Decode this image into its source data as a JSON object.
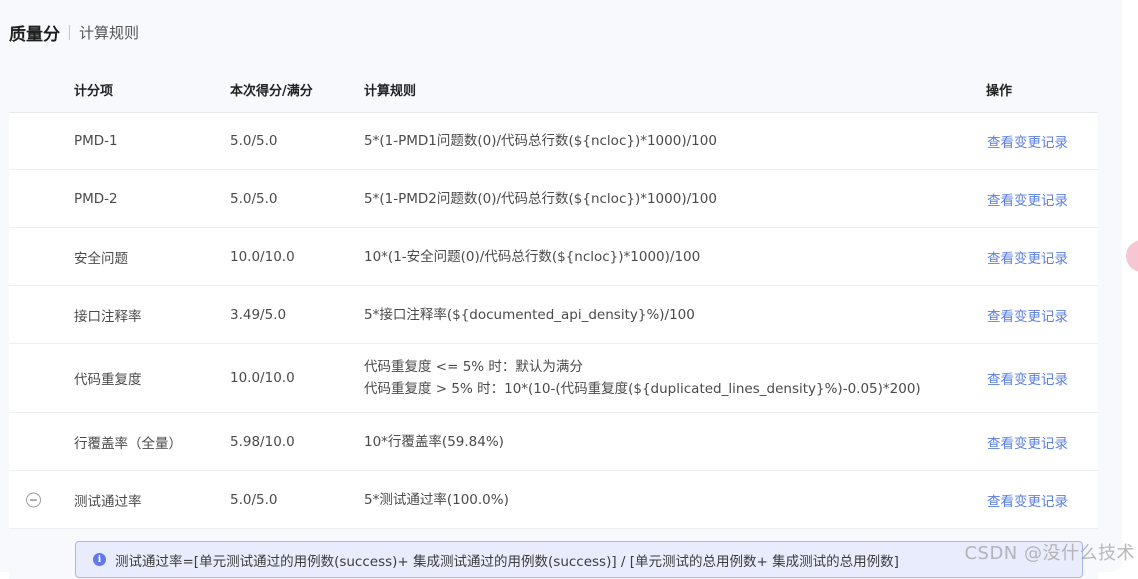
{
  "header": {
    "title": "质量分",
    "subtitle": "计算规则"
  },
  "table": {
    "columns": {
      "item": "计分项",
      "score": "本次得分/满分",
      "rule": "计算规则",
      "op": "操作"
    },
    "rows": [
      {
        "item": "PMD-1",
        "score": "5.0/5.0",
        "rule": [
          "5*(1-PMD1问题数(0)/代码总行数(${ncloc})*1000)/100"
        ],
        "op": "查看变更记录"
      },
      {
        "item": "PMD-2",
        "score": "5.0/5.0",
        "rule": [
          "5*(1-PMD2问题数(0)/代码总行数(${ncloc})*1000)/100"
        ],
        "op": "查看变更记录"
      },
      {
        "item": "安全问题",
        "score": "10.0/10.0",
        "rule": [
          "10*(1-安全问题(0)/代码总行数(${ncloc})*1000)/100"
        ],
        "op": "查看变更记录"
      },
      {
        "item": "接口注释率",
        "score": "3.49/5.0",
        "rule": [
          "5*接口注释率(${documented_api_density}%)/100"
        ],
        "op": "查看变更记录"
      },
      {
        "item": "代码重复度",
        "score": "10.0/10.0",
        "rule": [
          "代码重复度 <= 5% 时：默认为满分",
          "代码重复度 > 5% 时：10*(10-(代码重复度(${duplicated_lines_density}%)-0.05)*200)"
        ],
        "op": "查看变更记录"
      },
      {
        "item": "行覆盖率（全量）",
        "score": "5.98/10.0",
        "rule": [
          "10*行覆盖率(59.84%)"
        ],
        "op": "查看变更记录"
      },
      {
        "item": "测试通过率",
        "score": "5.0/5.0",
        "rule": [
          "5*测试通过率(100.0%)"
        ],
        "op": "查看变更记录",
        "expander": "−"
      }
    ],
    "expanded_info": "测试通过率=[单元测试通过的用例数(success)+ 集成测试通过的用例数(success)] / [单元测试的总用例数+ 集成测试的总用例数]"
  },
  "watermark": "CSDN @没什么技术",
  "colors": {
    "link": "#5b7fe3",
    "info_bg": "#e9ecfd",
    "info_border": "#aab6f4",
    "info_icon": "#6277e8"
  },
  "icons": {
    "info": "info-circle-icon",
    "collapse": "minus-circle-icon"
  }
}
